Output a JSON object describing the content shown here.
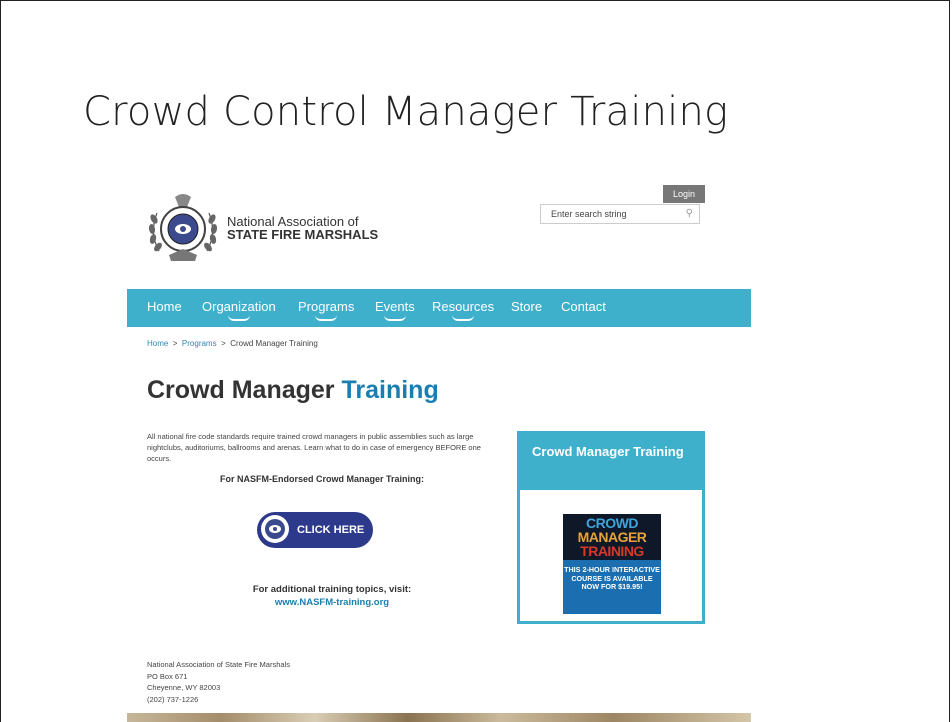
{
  "slide": {
    "title": "Crowd Control Manager Training"
  },
  "header": {
    "org_line1": "National Association of",
    "org_line2": "STATE FIRE MARSHALS",
    "login_label": "Login",
    "search_placeholder": "Enter search string"
  },
  "nav": {
    "items": [
      {
        "label": "Home"
      },
      {
        "label": "Organization"
      },
      {
        "label": "Programs"
      },
      {
        "label": "Events"
      },
      {
        "label": "Resources"
      },
      {
        "label": "Store"
      },
      {
        "label": "Contact"
      }
    ]
  },
  "breadcrumb": {
    "home": "Home",
    "sep": ">",
    "programs": "Programs",
    "current": "Crowd Manager Training"
  },
  "main": {
    "heading_part1": "Crowd Manager",
    "heading_part2": "Training",
    "intro": "All national fire code standards require trained crowd managers in public assemblies such as large nightclubs, auditoriums, ballrooms and arenas.  Learn what to do in case of emergency BEFORE one occurs.",
    "endorsed_label": "For NASFM-Endorsed Crowd Manager Training:",
    "click_here": "CLICK HERE",
    "additional_label": "For additional training topics, visit:",
    "additional_url": "www.NASFM-training.org"
  },
  "sidebar": {
    "title": "Crowd Manager Training",
    "promo_line1": "CROWD",
    "promo_line2": "MANAGER",
    "promo_line3": "TRAINING",
    "promo_text": "THIS 2-HOUR INTERACTIVE COURSE IS AVAILABLE NOW FOR $19.95!"
  },
  "footer": {
    "line1": "National Association of State Fire Marshals",
    "line2": "PO Box 671",
    "line3": "Cheyenne, WY 82003",
    "line4": "(202) 737-1226"
  },
  "colors": {
    "nav_bg": "#3fb0cc",
    "accent": "#1a7fb0",
    "button_bg": "#2d3a8c"
  }
}
